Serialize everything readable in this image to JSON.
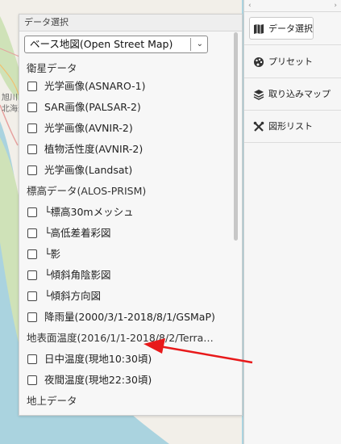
{
  "map": {
    "labels": [
      "旭川市",
      "北海道"
    ]
  },
  "panel": {
    "title": "データ選択",
    "base_map": "ベース地図(Open Street Map)",
    "rows": [
      {
        "type": "heading",
        "label": "衛星データ"
      },
      {
        "type": "item",
        "label": "光学画像(ASNARO-1)",
        "checked": false
      },
      {
        "type": "item",
        "label": "SAR画像(PALSAR-2)",
        "checked": false
      },
      {
        "type": "item",
        "label": "光学画像(AVNIR-2)",
        "checked": false
      },
      {
        "type": "item",
        "label": "植物活性度(AVNIR-2)",
        "checked": false
      },
      {
        "type": "item",
        "label": "光学画像(Landsat)",
        "checked": false
      },
      {
        "type": "heading",
        "label": "標高データ(ALOS-PRISM)"
      },
      {
        "type": "item",
        "label": "└標高30mメッシュ",
        "checked": false
      },
      {
        "type": "item",
        "label": "└高低差着彩図",
        "checked": false
      },
      {
        "type": "item",
        "label": "└影",
        "checked": false
      },
      {
        "type": "item",
        "label": "└傾斜角陰影図",
        "checked": false
      },
      {
        "type": "item",
        "label": "└傾斜方向図",
        "checked": false
      },
      {
        "type": "item",
        "label": "降雨量(2000/3/1-2018/8/1/GSMaP)",
        "checked": false
      },
      {
        "type": "heading",
        "label": "地表面温度(2016/1/1-2018/8/2/Terra…"
      },
      {
        "type": "item",
        "label": "日中温度(現地10:30頃)",
        "checked": false
      },
      {
        "type": "item",
        "label": "夜間温度(現地22:30頃)",
        "checked": false
      },
      {
        "type": "heading",
        "label": "地上データ"
      }
    ]
  },
  "toolbar": {
    "collapse_left": "‹",
    "collapse_right": "›",
    "items": [
      {
        "label": "データ選択",
        "icon": "map-icon",
        "active": true
      },
      {
        "label": "プリセット",
        "icon": "palette-icon",
        "active": false
      },
      {
        "label": "取り込みマップ",
        "icon": "layers-icon",
        "active": false
      },
      {
        "label": "図形リスト",
        "icon": "tools-icon",
        "active": false
      }
    ]
  },
  "colors": {
    "arrow": "#e8191a",
    "sea": "#aad3df",
    "land": "#f2efe9",
    "forest": "#cfe2b8"
  }
}
